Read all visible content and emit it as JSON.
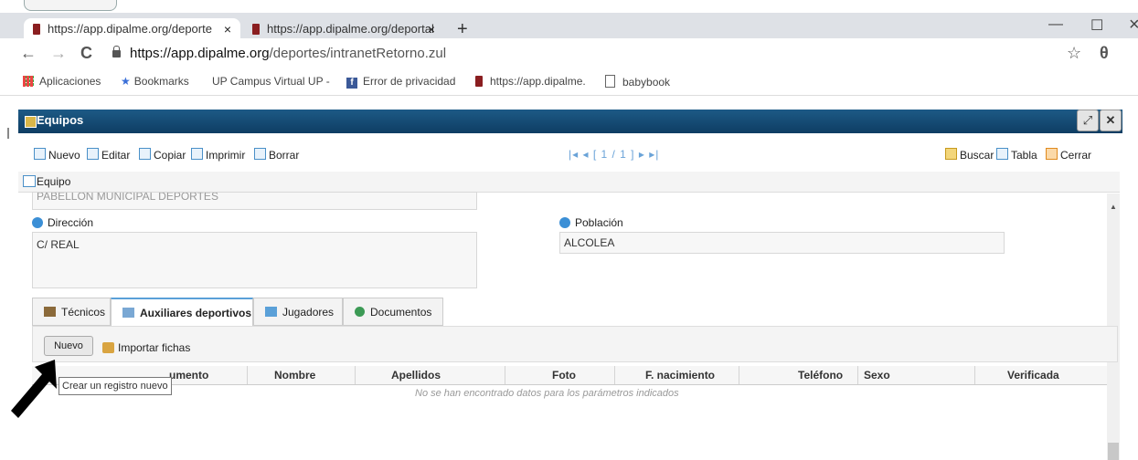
{
  "browser": {
    "tabs": [
      {
        "label": "https://app.dipalme.org/deporte"
      },
      {
        "label": "https://app.dipalme.org/deportal"
      }
    ],
    "tab_close": "×",
    "new_tab": "+",
    "window": {
      "minimize": "—",
      "maximize": "☐",
      "close": "×"
    },
    "nav": {
      "back": "←",
      "forward": "→",
      "reload": "C"
    },
    "url_host": "https://app.dipalme.org",
    "url_path": "/deportes/intranetRetorno.zul",
    "star": "☆",
    "profile": "θ",
    "bookmarks": [
      "Aplicaciones",
      "Bookmarks",
      "UP Campus Virtual UP -",
      "Error de privacidad",
      "https://app.dipalme.",
      "babybook"
    ]
  },
  "app": {
    "window_title": "Equipos",
    "expand_icon": "⤢",
    "close_icon": "✕",
    "toolbar": {
      "nuevo": "Nuevo",
      "editar": "Editar",
      "copiar": "Copiar",
      "imprimir": "Imprimir",
      "borrar": "Borrar",
      "pager": "|◂ ◂ [ 1 / 1 ] ▸ ▸|",
      "buscar": "Buscar",
      "tabla": "Tabla",
      "cerrar": "Cerrar"
    },
    "section_title": "Equipo",
    "cutoff_value": "PABELLON MUNICIPAL DEPORTES",
    "direccion": {
      "label": "Dirección",
      "value": "C/ REAL"
    },
    "poblacion": {
      "label": "Población",
      "value": "ALCOLEA"
    },
    "tabs": [
      {
        "label": "Técnicos"
      },
      {
        "label": "Auxiliares deportivos"
      },
      {
        "label": "Jugadores"
      },
      {
        "label": "Documentos"
      }
    ],
    "subtoolbar": {
      "nuevo": "Nuevo",
      "importar": "Importar fichas"
    },
    "grid_columns": {
      "documento": "umento",
      "nombre": "Nombre",
      "apellidos": "Apellidos",
      "foto": "Foto",
      "nacimiento": "F. nacimiento",
      "telefono": "Teléfono",
      "sexo": "Sexo",
      "verificada": "Verificada"
    },
    "empty_message": "No se han encontrado datos para los parámetros indicados",
    "tooltip": "Crear un registro nuevo"
  },
  "colors": {
    "titlebar": "#0e3d63",
    "link_blue": "#4a90c8",
    "tab_bg": "#dee1e6",
    "arrow": "#000000"
  }
}
